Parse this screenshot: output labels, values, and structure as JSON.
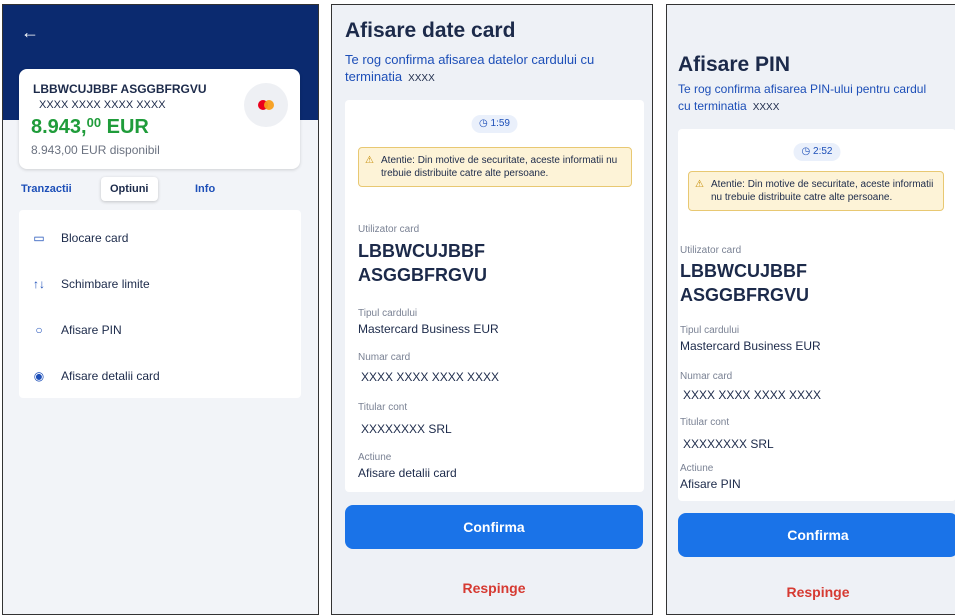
{
  "screen1": {
    "back_icon": "arrow-left-icon",
    "card_name": "LBBWCUJBBF ASGGBFRGVU",
    "card_number": "XXXX XXXX XXXX XXXX",
    "balance_main": "8.943,",
    "balance_cents": "00",
    "balance_currency": " EUR",
    "available": "8.943,00 EUR disponibil",
    "tabs": [
      "Tranzactii",
      "Optiuni",
      "Info"
    ],
    "menu": [
      {
        "label": "Blocare card",
        "icon": "card-block-icon"
      },
      {
        "label": "Schimbare limite",
        "icon": "arrows-updown-icon"
      },
      {
        "label": "Afisare PIN",
        "icon": "pin-icon"
      },
      {
        "label": "Afisare detalii card",
        "icon": "eye-icon"
      }
    ]
  },
  "screen2": {
    "title": "Afisare date card",
    "subtitle": "Te rog confirma afisarea datelor cardului cu terminatia",
    "subtitle_mask": "XXXX",
    "timer": "1:59",
    "warning": "Atentie: Din motive de securitate, aceste informatii nu trebuie distribuite catre alte persoane.",
    "user_label": "Utilizator card",
    "user_line1": "LBBWCUJBBF",
    "user_line2": "ASGGBFRGVU",
    "type_label": "Tipul cardului",
    "type_value": "Mastercard Business EUR",
    "number_label": "Numar card",
    "number_value": "XXXX XXXX XXXX XXXX",
    "holder_label": "Titular cont",
    "holder_value": "XXXXXXXX SRL",
    "action_label": "Actiune",
    "action_value": "Afisare detalii card",
    "confirm": "Confirma",
    "reject": "Respinge"
  },
  "screen3": {
    "title": "Afisare PIN",
    "subtitle_line1": "Te rog confirma afisarea PIN-ului pentru cardul",
    "subtitle_line2": "cu terminatia",
    "subtitle_mask": "XXXX",
    "timer": "2:52",
    "warning": "Atentie: Din motive de securitate, aceste informatii nu trebuie distribuite catre alte persoane.",
    "user_label": "Utilizator card",
    "user_line1": "LBBWCUJBBF",
    "user_line2": "ASGGBFRGVU",
    "type_label": "Tipul cardului",
    "type_value": "Mastercard Business EUR",
    "number_label": "Numar card",
    "number_value": "XXXX XXXX XXXX XXXX",
    "holder_label": "Titular cont",
    "holder_value": "XXXXXXXX SRL",
    "action_label": "Actiune",
    "action_value": "Afisare PIN",
    "confirm": "Confirma",
    "reject": "Respinge"
  }
}
